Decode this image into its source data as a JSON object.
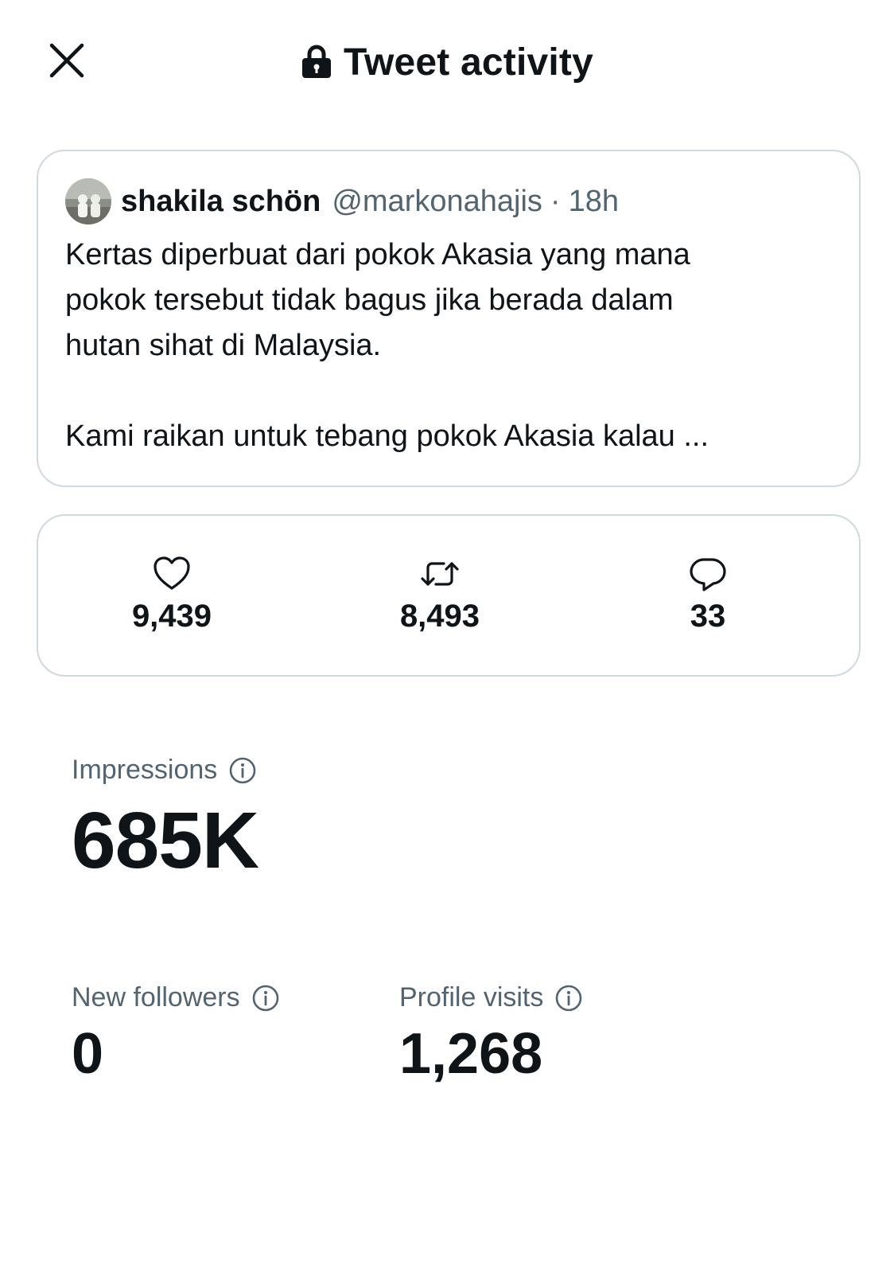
{
  "header": {
    "title": "Tweet activity",
    "close_icon": "close-icon",
    "lock_icon": "lock-icon"
  },
  "tweet": {
    "author_name": "shakila schön",
    "author_handle": "@markonahajis",
    "separator": "·",
    "time": "18h",
    "lines": [
      "Kertas diperbuat dari pokok Akasia yang mana",
      "pokok tersebut tidak bagus jika berada dalam",
      "hutan sihat di Malaysia."
    ],
    "line_after_gap": "Kami raikan untuk tebang pokok Akasia kalau ..."
  },
  "engagement": {
    "likes": "9,439",
    "retweets": "8,493",
    "replies": "33"
  },
  "metrics": {
    "impressions_label": "Impressions",
    "impressions_value": "685K",
    "new_followers_label": "New followers",
    "new_followers_value": "0",
    "profile_visits_label": "Profile visits",
    "profile_visits_value": "1,268"
  },
  "colors": {
    "text_primary": "#0f1419",
    "text_secondary": "#536471",
    "border": "#cfd9de"
  }
}
